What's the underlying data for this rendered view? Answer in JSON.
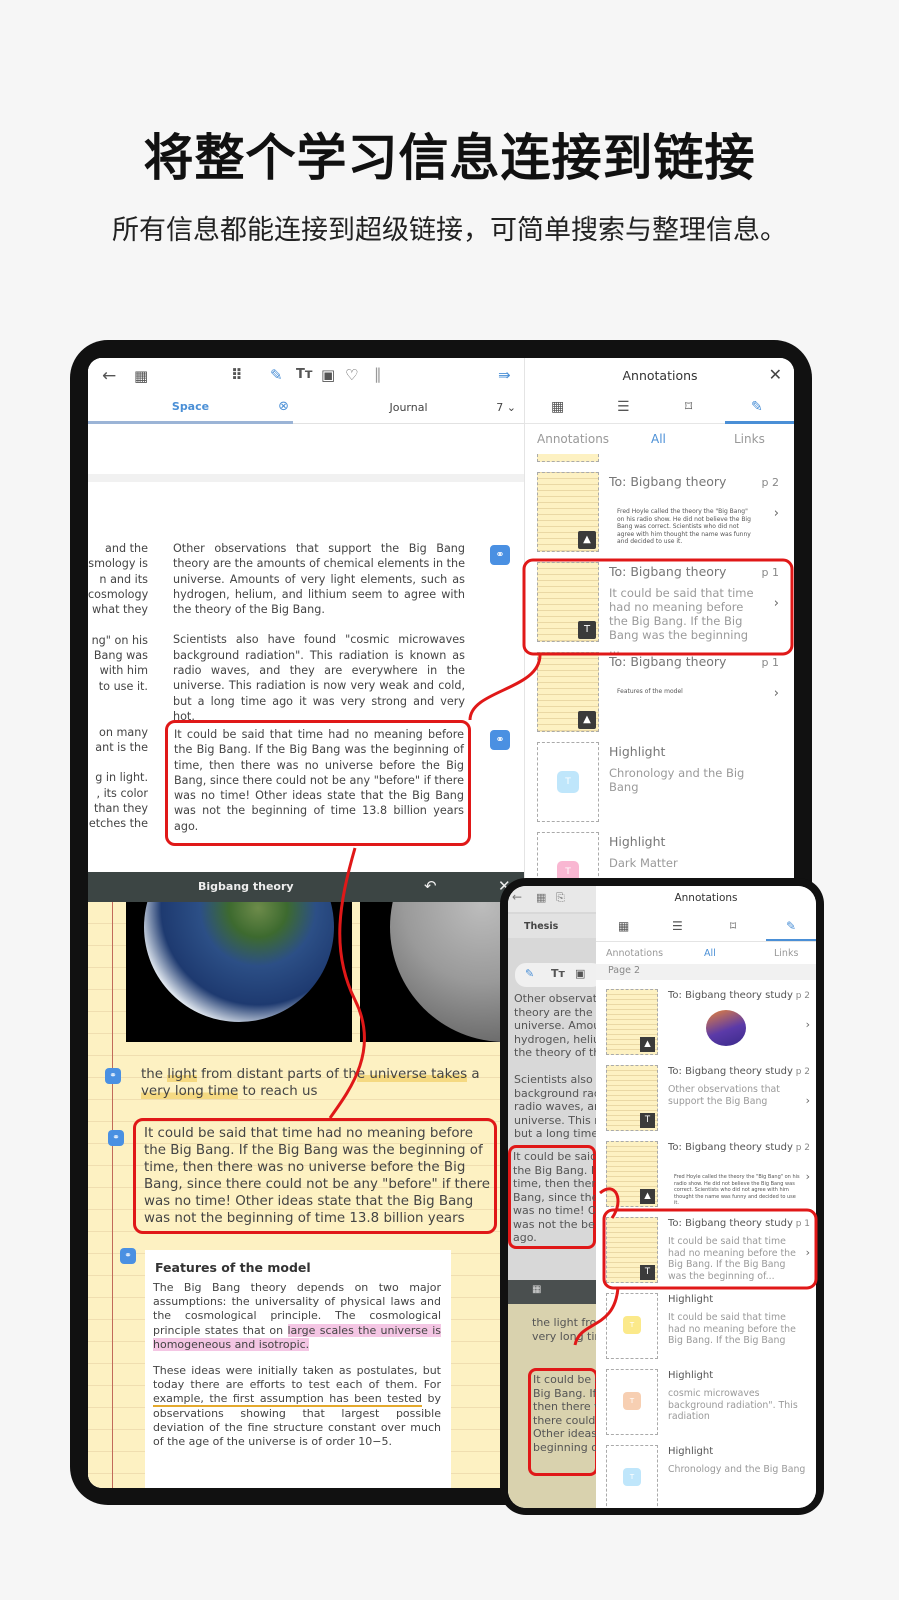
{
  "headline": "将整个学习信息连接到链接",
  "subline": "所有信息都能连接到超级链接，可简单搜索与整理信息。",
  "colors": {
    "accent": "#4a8fd6",
    "highlight_red": "#e01818",
    "notebook_yellow": "#fdf1c2",
    "link_blue": "#4a90e2"
  },
  "tablet": {
    "toolbar": {
      "icons": [
        "back-arrow-icon",
        "grid-view-icon",
        "apps-grid-icon",
        "pen-icon",
        "text-tool-icon",
        "image-tool-icon",
        "lasso-icon",
        "pause-icon",
        "collapse-panel-icon"
      ]
    },
    "tabs": [
      {
        "label": "Space",
        "active": true
      },
      {
        "label": "Journal",
        "active": false,
        "page": "7"
      }
    ],
    "doc": {
      "left_fragments": [
        "and the",
        "smology is",
        "n and its",
        "cosmology",
        "what they",
        "",
        "ng\" on his",
        "Bang was",
        "with him",
        "to use it.",
        "",
        "",
        "on many",
        "ant is the",
        "",
        "g in light.",
        ", its color",
        "than they",
        "etches the"
      ],
      "paragraphs": [
        "Other observations that support the Big Bang theory are the amounts of chemical elements in the universe. Amounts of very light elements, such as hydrogen, helium, and lithium seem to agree with the theory of the Big Bang.",
        "Scientists also have found \"cosmic microwaves background radiation\". This radiation is known as radio waves, and they are everywhere in the universe. This radiation is now very weak and cold, but a long time ago it was very strong and very hot."
      ],
      "linked_paragraph": "It could be said that time had no meaning before the Big Bang. If the Big Bang was the beginning of time, then there was no universe before the Big Bang, since there could not be any \"before\" if there was no time! Other ideas state that the Big Bang was not the beginning of time 13.8 billion years ago."
    },
    "notebook": {
      "title": "Bigbang theory",
      "line1_pre": "the ",
      "line1_hl1": "light",
      "line1_mid": " from distant parts of th",
      "line1_hl2": "e universe takes",
      "line1_post": " a",
      "line2_hl": "very long time",
      "line2_post": " to reach us",
      "linked_text": "It could be said that time had no meaning before the Big Bang. If the Big Bang was the beginning of time, then there was no universe before the Big Bang, since there could not be any \"before\" if there was no time! Other ideas state that the Big Bang was not the beginning of time 13.8 billion years",
      "features_title": "Features of the model",
      "features_p1_pre": "The Big Bang theory depends on two major assumptions: the universality of physical laws and the cosmological principle. The cosmological principle states that on ",
      "features_p1_hl": "large scales the universe is homogeneous and isotropic.",
      "features_p2_pre": "These ideas were initially taken as postulates, but today there are efforts to test each of them. For ",
      "features_p2_ul": "example, the first assumption has been tested",
      "features_p2_post": " by observations showing that largest possible deviation of the fine structure constant over much of the age of the universe is of order 10−5."
    },
    "panel": {
      "title": "Annotations",
      "filters": {
        "left": "Annotations",
        "center": "All",
        "right": "Links"
      },
      "cards": [
        {
          "title": "To: Bigbang theory",
          "page": "p 2",
          "type": "image",
          "body": "Fred Hoyle called the theory the \"Big Bang\" on his radio show. He did not believe the Big Bang was correct. Scientists who did not agree with him thought the name was funny and decided to use it."
        },
        {
          "title": "To: Bigbang theory",
          "page": "p 1",
          "type": "text",
          "body": "It could be said that time had no meaning before the Big Bang. If the Big Bang was the beginning ..."
        },
        {
          "title": "To: Bigbang theory",
          "page": "p 1",
          "type": "image",
          "body": "Features of the model"
        },
        {
          "title": "Highlight",
          "type": "highlight",
          "chip_color": "#bfe6fb",
          "body": "Chronology and the Big Bang"
        },
        {
          "title": "Highlight",
          "type": "highlight",
          "chip_color": "#f9b7d2",
          "body": "Dark Matter"
        }
      ]
    }
  },
  "phone": {
    "tab_label": "Thesis",
    "panel_title": "Annotations",
    "filters": {
      "left": "Annotations",
      "center": "All",
      "right": "Links"
    },
    "section": "Page 2",
    "left_lines_top": [
      "Other observati",
      "theory are the ar",
      "universe. Amour",
      "hydrogen, heliur",
      "the theory of the",
      "",
      "Scientists also",
      "background radi",
      "radio waves, ar",
      "universe. This ra",
      "but a long time a"
    ],
    "left_lines_box": [
      "It could be said",
      "the Big Bang. If",
      "time, then there",
      "Bang, since there",
      "was no time! Ot",
      "was not the beg",
      "ago."
    ],
    "left_lines_nb": [
      "the light fro",
      "very long tin"
    ],
    "left_lines_nb_box": [
      "It could be s",
      "Big Bang. If",
      "then there v",
      "there could",
      "Other ideas",
      "beginning o"
    ],
    "cards": [
      {
        "title": "To: Bigbang theory study",
        "page": "p 2",
        "type": "image",
        "body": ""
      },
      {
        "title": "To: Bigbang theory study",
        "page": "p 2",
        "type": "text",
        "body": "Other observations that support the Big Bang"
      },
      {
        "title": "To: Bigbang theory study",
        "page": "p 2",
        "type": "image",
        "body": "Fred Hoyle called the theory the \"Big Bang\" on his radio show. He did not believe the Big Bang was correct. Scientists who did not agree with him thought the name was funny and decided to use it."
      },
      {
        "title": "To: Bigbang theory study",
        "page": "p 1",
        "type": "text",
        "body": "It could be said that time had no meaning before the Big Bang. If the Big Bang was the beginning of..."
      },
      {
        "title": "Highlight",
        "type": "highlight",
        "chip_color": "#fbe98a",
        "body": "It could be said that time had no meaning before the Big Bang. If the Big Bang"
      },
      {
        "title": "Highlight",
        "type": "highlight",
        "chip_color": "#f7cfb2",
        "body": "cosmic microwaves background radiation\". This radiation"
      },
      {
        "title": "Highlight",
        "type": "highlight",
        "chip_color": "#bfe6fb",
        "body": "Chronology and the Big Bang"
      }
    ]
  }
}
